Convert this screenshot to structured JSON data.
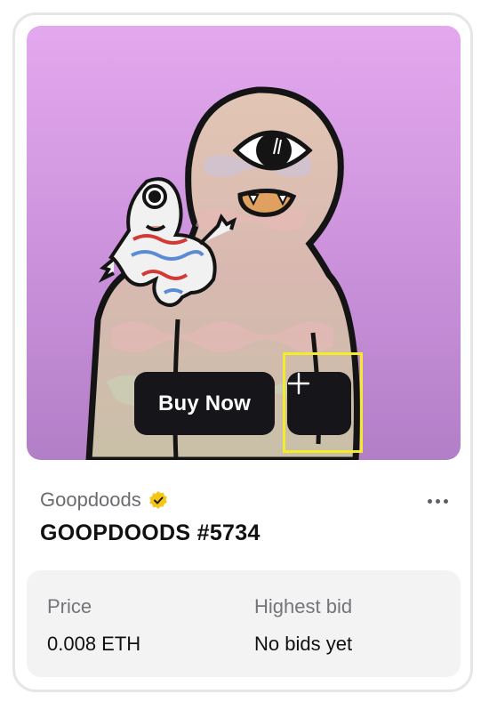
{
  "card": {
    "buy_now_label": "Buy Now",
    "add_icon": "plus-icon",
    "more_icon": "more-horizontal-icon",
    "verified_icon": "verified-badge-icon",
    "collection_name": "Goopdoods",
    "token_name": "GOOPDOODS #5734",
    "price_label": "Price",
    "price_value": "0.008 ETH",
    "highest_bid_label": "Highest bid",
    "highest_bid_value": "No bids yet"
  },
  "colors": {
    "image_background": "#e3a8ee",
    "button_background": "#16161a",
    "highlight": "#f4ec2a",
    "verified_badge": "#f5c518"
  }
}
